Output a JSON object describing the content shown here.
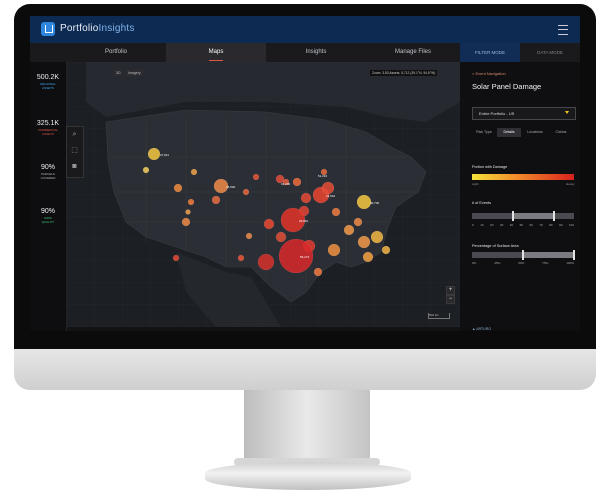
{
  "app": {
    "brand_part1": "Portfolio",
    "brand_part2": "Insights"
  },
  "nav": {
    "tabs": [
      "Portfolio",
      "Maps",
      "Insights",
      "Manage Files"
    ],
    "active_tab": "Maps",
    "filter_mode": "FILTER MODE",
    "data_mode": "DATA MODE"
  },
  "stats": [
    {
      "value": "500.2K",
      "label": "REGIONAL\nASSETS",
      "color": "#3fa9f5"
    },
    {
      "value": "325.1K",
      "label": "COMMERCIAL\nASSETS",
      "color": "#e0574a"
    },
    {
      "value": "90%",
      "label": "PARCELS\nCOVERED",
      "color": "#b7b7b7"
    },
    {
      "value": "90%",
      "label": "DATA\nQUALITY",
      "color": "#3fcf7b"
    }
  ],
  "map": {
    "tag1": "3D",
    "tag2": "Imagery",
    "coord_readout": "Zoom: 3.83  Assets: 5,712  (39.1°N, 94.6°W)",
    "zoom_in": "+",
    "zoom_out": "−",
    "scale": "500 km",
    "bubble_labels": [
      "27,911",
      "46,520",
      "31,200",
      "21,510",
      "30,730",
      "29,810",
      "56,274",
      "51,210"
    ]
  },
  "panel": {
    "back_link": "< Event Navigation",
    "title": "Solar Panel Damage",
    "select_value": "Entire Portfolio - US",
    "subtabs": [
      "Risk Type",
      "Details",
      "Locations",
      "Claims"
    ],
    "active_subtab": "Details",
    "damage_label": "Portion with Damage",
    "legend_low": "Light",
    "legend_high": "Heavy",
    "events_label": "# of Events",
    "events_ticks": [
      "0",
      "10",
      "20",
      "30",
      "40",
      "50",
      "60",
      "70",
      "80",
      "90",
      "100"
    ],
    "events_range": [
      40,
      80
    ],
    "surface_label": "Percentage of Surface Area",
    "surface_ticks": [
      "0%",
      "25%",
      "50%",
      "75%",
      "100%"
    ],
    "surface_range": [
      50,
      100
    ],
    "footer_brand": "ARTURO"
  }
}
